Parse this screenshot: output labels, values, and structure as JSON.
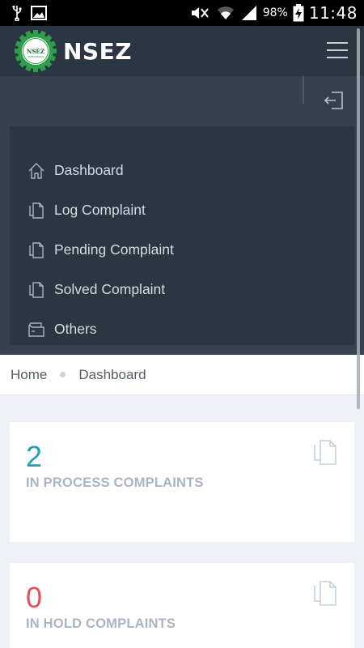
{
  "status_bar": {
    "battery": "98%",
    "time": "11:48",
    "icons": [
      "usb-icon",
      "image-notification-icon",
      "mute-icon",
      "wifi-icon",
      "signal-icon",
      "battery-charging-icon"
    ]
  },
  "header": {
    "logo_text": "NSEZ",
    "title": "NSEZ",
    "menu_icon": "hamburger-icon"
  },
  "sidebar": {
    "logout_icon": "logout-icon",
    "items": [
      {
        "label": "Dashboard",
        "icon": "home-icon"
      },
      {
        "label": "Log Complaint",
        "icon": "document-icon"
      },
      {
        "label": "Pending Complaint",
        "icon": "document-icon"
      },
      {
        "label": "Solved Complaint",
        "icon": "document-icon"
      },
      {
        "label": "Others",
        "icon": "wallet-icon"
      }
    ]
  },
  "breadcrumb": {
    "home": "Home",
    "current": "Dashboard"
  },
  "stats": [
    {
      "value": "2",
      "label": "IN PROCESS COMPLAINTS",
      "color": "#26a0b0",
      "icon": "copy-icon"
    },
    {
      "value": "0",
      "label": "IN HOLD COMPLAINTS",
      "color": "#e7505a",
      "icon": "copy-icon"
    }
  ],
  "colors": {
    "header_bg": "#2b3643",
    "sidebar_bg": "#364150",
    "menu_text": "#d4dbe4",
    "stat_label": "#a8b5c3"
  }
}
